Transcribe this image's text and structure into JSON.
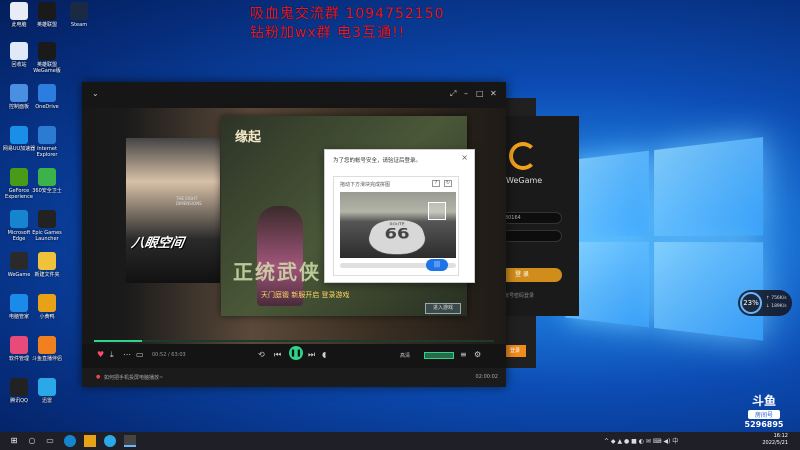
{
  "overlay": {
    "line1": "吸血鬼交流群   1094752150",
    "line2": "钻粉加wx群    电3互通!!"
  },
  "desktop_icons": [
    {
      "label": "此电脑",
      "color": "#e8edf5",
      "icon": "computer-icon"
    },
    {
      "label": "英雄联盟",
      "color": "#1a1a1a",
      "icon": "lol-icon"
    },
    {
      "label": "Steam",
      "color": "#1b2a44",
      "icon": "steam-icon"
    },
    {
      "label": "回收站",
      "color": "#dfe9f7",
      "icon": "recycle-bin-icon"
    },
    {
      "label": "英雄联盟 WeGame版",
      "color": "#1a1a1a",
      "icon": "lol-wegame-icon"
    },
    {
      "label": "控制面板",
      "color": "#4b8fe0",
      "icon": "control-panel-icon"
    },
    {
      "label": "OneDrive",
      "color": "#2b7de0",
      "icon": "onedrive-icon"
    },
    {
      "label": "网易UU加速器",
      "color": "#1a8fe8",
      "icon": "uu-icon"
    },
    {
      "label": "Internet Explorer",
      "color": "#2c7bd3",
      "icon": "ie-icon"
    },
    {
      "label": "GeForce Experience",
      "color": "#4a9a1a",
      "icon": "nvidia-icon"
    },
    {
      "label": "360安全卫士",
      "color": "#3cb24a",
      "icon": "security-icon"
    },
    {
      "label": "Microsoft Edge",
      "color": "#1685d0",
      "icon": "edge-icon"
    },
    {
      "label": "Epic Games Launcher",
      "color": "#222",
      "icon": "epic-icon"
    },
    {
      "label": "WeGame",
      "color": "#2a2a2a",
      "icon": "wegame-icon"
    },
    {
      "label": "新建文件夹",
      "color": "#f0c23c",
      "icon": "folder-icon"
    },
    {
      "label": "电脑管家",
      "color": "#1a8be8",
      "icon": "pc-manager-icon"
    },
    {
      "label": "小黄鸭",
      "color": "#e8a218",
      "icon": "duck-icon"
    },
    {
      "label": "软件管理",
      "color": "#e84a7a",
      "icon": "apps-icon"
    },
    {
      "label": "斗鱼直播伴侣",
      "color": "#f08020",
      "icon": "douyu-icon"
    },
    {
      "label": "腾讯QQ",
      "color": "#222",
      "icon": "qq-icon"
    },
    {
      "label": "迅雷",
      "color": "#2aa8e8",
      "icon": "thunder-icon"
    }
  ],
  "player": {
    "poster_title": "八眼空间",
    "poster_caption": "THE EIGHT DIMENSIONS",
    "time": "00:52 / 63:03",
    "quality": "高清",
    "status_left": "如何把手机投屏电脑播放~",
    "status_right": "02:00:02"
  },
  "launcher": {
    "game_title": "缘起",
    "art_text": "正统武侠",
    "banner": "天门庭锻   新服开启   登录游戏",
    "enter_button": "进入游戏"
  },
  "dialog": {
    "title": "为了您的帐号安全，请验证后登录。",
    "hint": "拖动下方滑块完成拼图",
    "shield_top": "ROUTE",
    "shield_num": "66",
    "knob": "|||"
  },
  "wegame": {
    "title": "WeGame",
    "account": "2972880164",
    "password": "",
    "login": "登 录",
    "footer": "帐号密码登录"
  },
  "widget": {
    "percent": "23%",
    "up": "↑ 756K/s",
    "down": "↓ 189K/s"
  },
  "watermark": {
    "logo": "斗鱼",
    "sub": "房间号",
    "room": "5296895"
  },
  "clock": {
    "time": "16:12",
    "date": "2022/5/21"
  },
  "side_button": "登录"
}
